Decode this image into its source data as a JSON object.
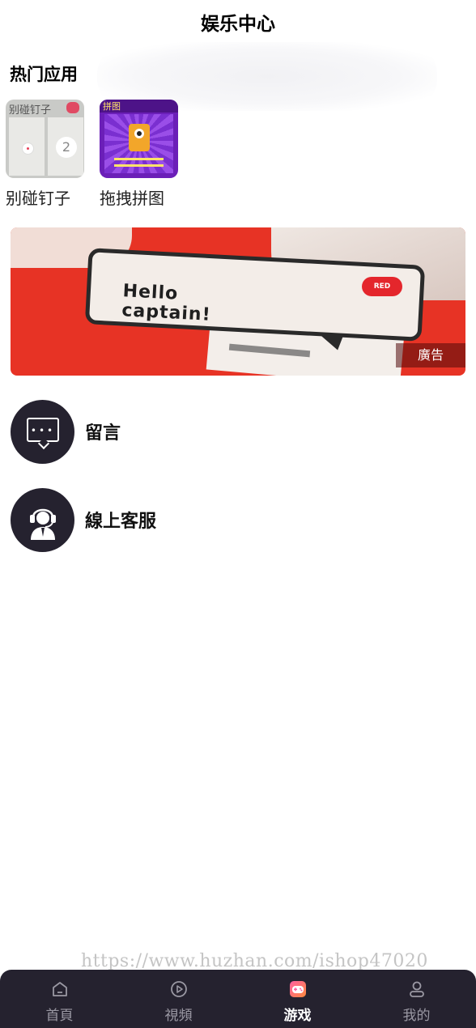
{
  "header": {
    "title": "娱乐中心"
  },
  "hot_apps": {
    "section_title": "热门应用",
    "apps": [
      {
        "name": "别碰钉子",
        "icon_caption": "别碰钉子",
        "icon_number": "2"
      },
      {
        "name": "拖拽拼图",
        "icon_caption": "拼图"
      }
    ]
  },
  "banner": {
    "headline_line1": "Hello",
    "headline_line2": "captain!",
    "badge": "RED",
    "ad_label": "廣告",
    "colors": {
      "primary": "#e73325",
      "bubble": "#f3ede8"
    }
  },
  "list": [
    {
      "label": "留言",
      "icon": "chat-bubble-icon"
    },
    {
      "label": "線上客服",
      "icon": "customer-service-agent-icon"
    }
  ],
  "watermark": "https://www.huzhan.com/ishop47020",
  "tabbar": {
    "background": "#25222f",
    "tabs": [
      {
        "label": "首頁",
        "icon": "home-icon",
        "active": false
      },
      {
        "label": "視頻",
        "icon": "play-circle-icon",
        "active": false
      },
      {
        "label": "游戏",
        "icon": "gamepad-icon",
        "active": true
      },
      {
        "label": "我的",
        "icon": "user-icon",
        "active": false
      }
    ]
  }
}
